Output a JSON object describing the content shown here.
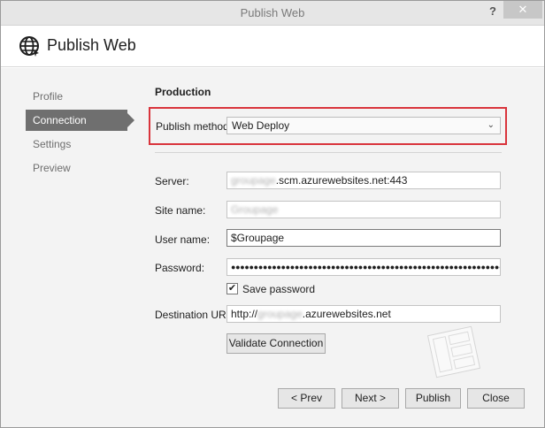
{
  "window": {
    "title": "Publish Web",
    "help_glyph": "?",
    "close_glyph": "✕"
  },
  "header": {
    "title": "Publish Web",
    "icon": "globe-icon"
  },
  "nav": {
    "items": [
      "Profile",
      "Connection",
      "Settings",
      "Preview"
    ],
    "active": "Connection"
  },
  "section": {
    "title": "Production"
  },
  "publish_method": {
    "label": "Publish method:",
    "selected": "Web Deploy",
    "chevron": "⌄"
  },
  "fields": {
    "server": {
      "label": "Server:",
      "value_blurred": "groupage",
      "value_suffix": ".scm.azurewebsites.net:443"
    },
    "site_name": {
      "label": "Site name:",
      "value_blurred": "Groupage"
    },
    "user_name": {
      "label": "User name:",
      "value": "$Groupage"
    },
    "password": {
      "label": "Password:",
      "value": "●●●●●●●●●●●●●●●●●●●●●●●●●●●●●●●●●●●●●●●●●●●●●●●●●●●●●●●●●●●●"
    },
    "save_password": {
      "label": "Save password",
      "checked_glyph": "✔"
    },
    "destination_url": {
      "label": "Destination URL:",
      "value_prefix": "http://",
      "value_blurred": "groupage",
      "value_suffix": ".azurewebsites.net"
    }
  },
  "buttons": {
    "validate": "Validate Connection",
    "prev": "< Prev",
    "next": "Next >",
    "publish": "Publish",
    "close": "Close"
  },
  "colors": {
    "highlight_border": "#d9343c",
    "active_nav": "#6f6f6f",
    "panel_bg": "#f3f3f3"
  }
}
